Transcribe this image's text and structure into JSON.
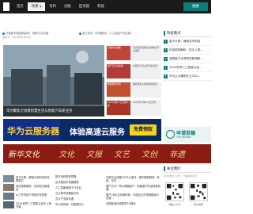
{
  "nav": {
    "items": [
      "首页",
      "场景",
      "有料",
      "创投",
      "区块链",
      "科技"
    ],
    "search_label": "搜索"
  },
  "ticker": [
    "打造数字赋能新高地，助推行业发展",
    "浙江发布《中国数创》人工智能产业发展..."
  ],
  "sub_label": "发布于：2024年06月14日",
  "hero": {
    "caption": "华为聚焦全场景智慧生活与智能汽车新业务"
  },
  "promos": [
    {
      "thumb": "中国平台领跑",
      "text": "打造数字赋能新高地推动产业发展"
    },
    {
      "thumb": "国产芯片新突破",
      "text": "中国芯片自主可控新进展"
    },
    {
      "thumb": "数据要素市场",
      "text": "数据要素价值释放新路径"
    },
    {
      "thumb": "2024全球人工智能大会",
      "text": "2024年全球AI大会召开"
    }
  ],
  "side": {
    "title": "科技看点",
    "items": [
      "量子计算：解锁未来科技",
      "科技视角解析：抗击人类...",
      "我国量子计算研究取得新...",
      "2024世界人工智能大会...",
      "华为云大模型在云与AI..."
    ]
  },
  "banner1": {
    "title": "华为云服务器",
    "middle": "体验高速云服务",
    "badge": "免费领取"
  },
  "banner2": {
    "title": "申请投稿",
    "sub": "THE REPORT"
  },
  "banner3": {
    "title": "新华文化",
    "words": [
      "文化",
      "文报",
      "文艺",
      "文创",
      "非遗"
    ]
  },
  "follow": {
    "title": "关注我们",
    "sub": "关注微信公众号，了解最新资讯",
    "qr_captions": [
      "微信公众号",
      "官方微博"
    ]
  },
  "news_left": [
    "量子计算：解锁未来科技的无限潜力",
    "科技视角解析：如何应对新挑战",
    "AI工作场景下的数字化转型",
    "2024世界人工智能大会在上海开幕",
    "华为发布新一代数据中心"
  ],
  "news_mid": [
    "数字化转型新思路",
    "区块链技术发展趋势",
    "人工智能赋能千行百业",
    "云计算市场格局分析",
    "芯片产业新机遇"
  ],
  "news_right": [
    "中国平台领跑TOP5大选洋：首年模型数量一年增，仅次...",
    "国产芯片厂商大规模量产，新能源汽车迎来新机遇",
    "国产2B企业加速布局：中国企业市场规模增长迅速...",
    "全国各地加快推进5G建设"
  ]
}
